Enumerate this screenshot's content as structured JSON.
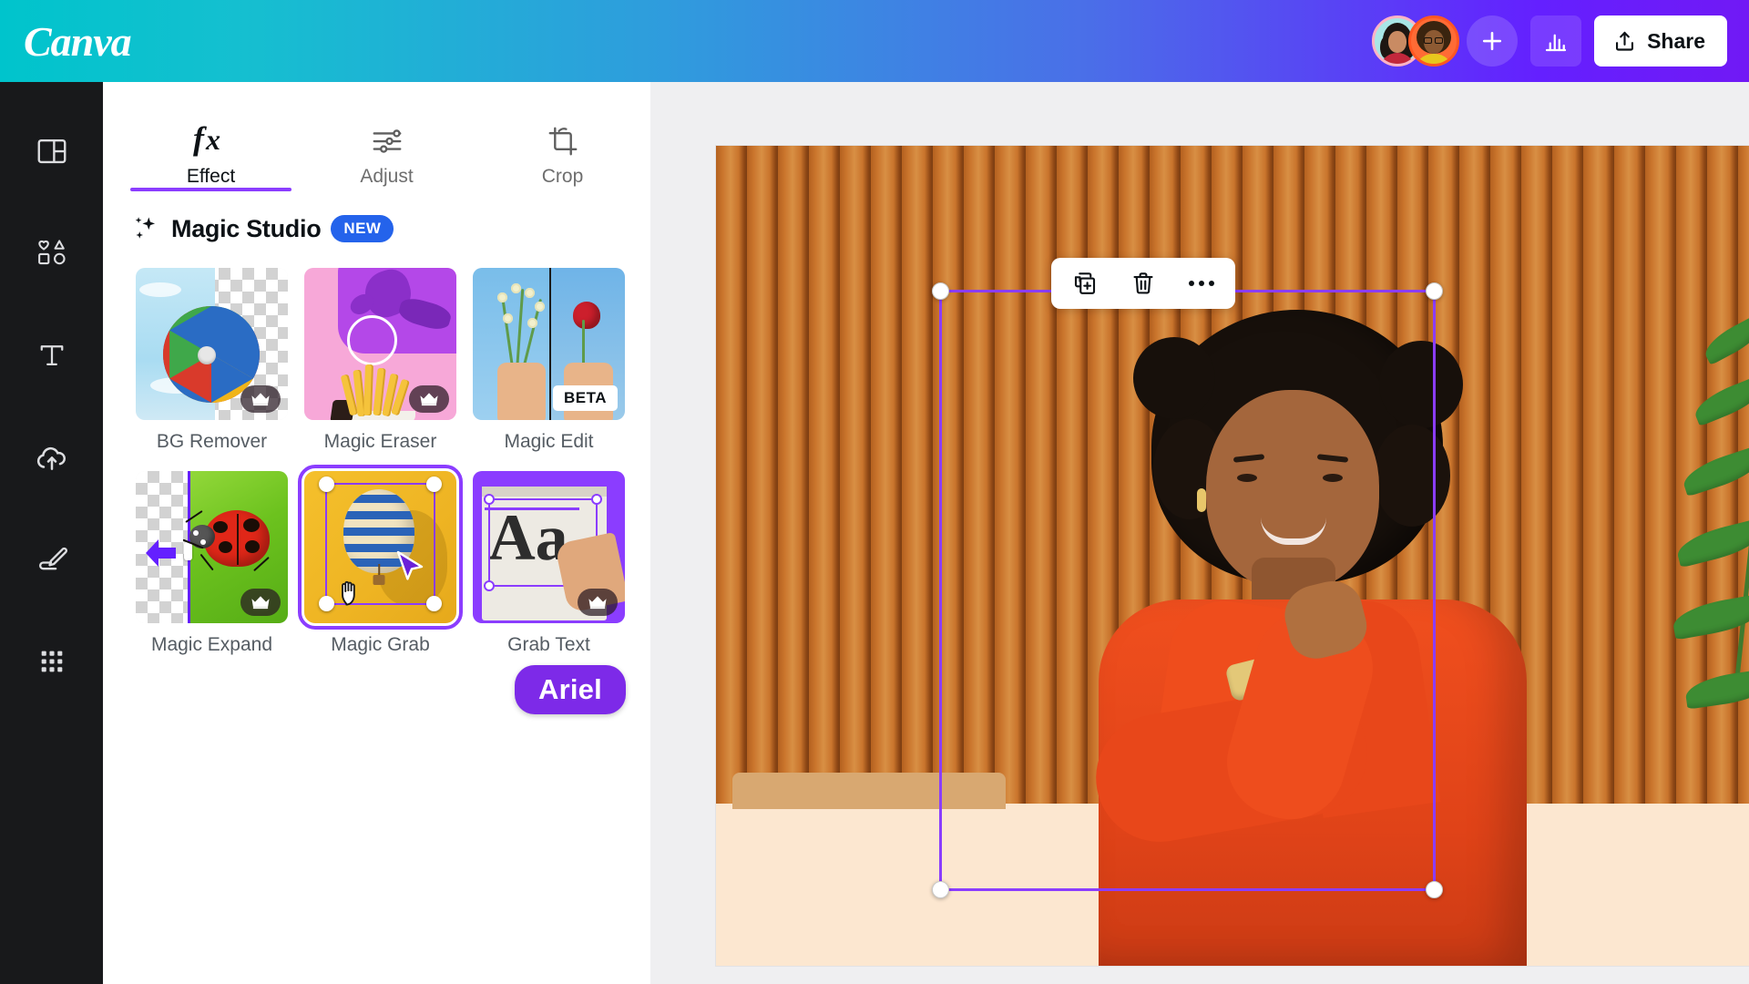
{
  "app": {
    "name": "Canva",
    "logo_text": "Canva"
  },
  "topbar": {
    "share_label": "Share",
    "icons": {
      "plus": "plus-icon",
      "analytics": "bar-chart-icon",
      "upload": "upload-icon"
    },
    "collaborators": [
      "avatar-1",
      "avatar-2"
    ],
    "gradient_from": "#00c4cc",
    "gradient_to": "#7119f5"
  },
  "rail": {
    "items": [
      {
        "name": "design",
        "icon": "layout-panel-icon"
      },
      {
        "name": "elements",
        "icon": "shapes-icon"
      },
      {
        "name": "text",
        "icon": "text-t-icon"
      },
      {
        "name": "uploads",
        "icon": "cloud-upload-icon"
      },
      {
        "name": "draw",
        "icon": "pen-draw-icon"
      },
      {
        "name": "apps",
        "icon": "grid-apps-icon"
      }
    ]
  },
  "panel": {
    "tabs": [
      {
        "label": "Effect",
        "icon": "fx-icon",
        "active": true
      },
      {
        "label": "Adjust",
        "icon": "sliders-icon",
        "active": false
      },
      {
        "label": "Crop",
        "icon": "crop-icon",
        "active": false
      }
    ],
    "section": {
      "title": "Magic Studio",
      "badge": "NEW",
      "badge_color": "#2463eb",
      "sparkle_icon": "sparkle-icon"
    },
    "tools": [
      {
        "label": "BG Remover",
        "badge": "crown",
        "selected": false
      },
      {
        "label": "Magic Eraser",
        "badge": "crown",
        "selected": false
      },
      {
        "label": "Magic Edit",
        "badge": "BETA",
        "selected": false
      },
      {
        "label": "Magic Expand",
        "badge": "crown",
        "selected": false
      },
      {
        "label": "Magic Grab",
        "badge": "none",
        "selected": true
      },
      {
        "label": "Grab Text",
        "badge": "crown",
        "selected": false
      }
    ]
  },
  "collaborator_cursor": {
    "name": "Ariel",
    "color": "#7d2ae8"
  },
  "canvas": {
    "accent_color": "#8b3dff",
    "floating_toolbar": [
      {
        "name": "duplicate",
        "icon": "duplicate-icon"
      },
      {
        "name": "delete",
        "icon": "trash-icon"
      },
      {
        "name": "more",
        "icon": "more-dots-icon"
      }
    ]
  }
}
